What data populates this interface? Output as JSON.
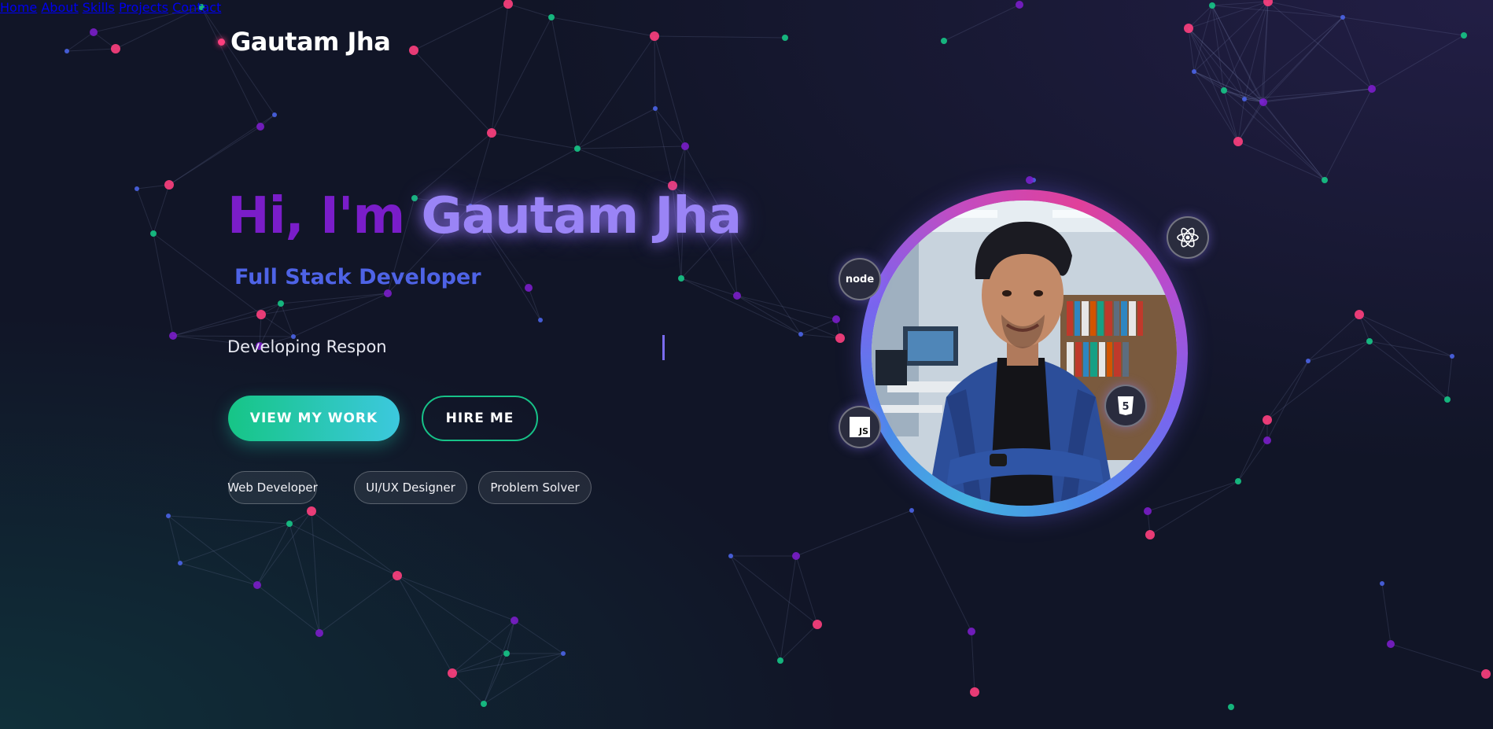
{
  "brand": {
    "name": "Gautam Jha",
    "dot_color": "#ff3f7e"
  },
  "nav": {
    "items": [
      "Home",
      "About",
      "Skills",
      "Projects",
      "Contact"
    ]
  },
  "hero": {
    "greeting": "Hi, I'm",
    "name": "Gautam Jha",
    "role": "Full Stack Developer",
    "typing_text": "Developing Respon",
    "primary_button": "VIEW MY WORK",
    "secondary_button": "HIRE ME",
    "tags": [
      "Web Developer",
      "UI/UX Designer",
      "Problem Solver"
    ]
  },
  "portrait": {
    "alt": "Portrait of Gautam Jha"
  },
  "floating_icons": [
    {
      "name": "nodejs-icon",
      "label": "node"
    },
    {
      "name": "react-icon",
      "label": ""
    },
    {
      "name": "javascript-icon",
      "label": "JS"
    },
    {
      "name": "html5-icon",
      "label": "5"
    }
  ],
  "colors": {
    "background": "#111527",
    "accent_purple": "#7a1dc9",
    "accent_violet": "#9a84f6",
    "accent_blue": "#4e63e6",
    "accent_green": "#16c586",
    "accent_cyan": "#3cc8de",
    "accent_pink": "#ff3f7e"
  }
}
